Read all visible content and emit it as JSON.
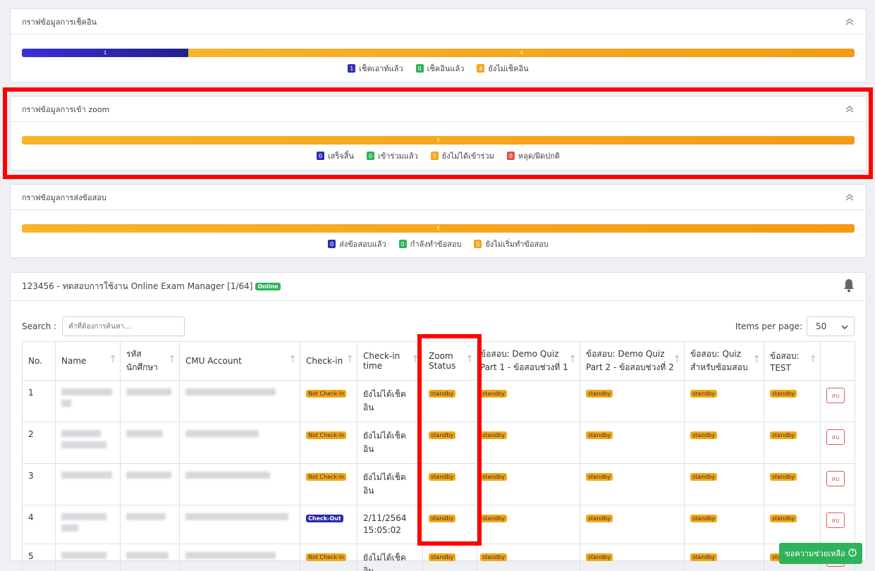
{
  "checkin_card": {
    "title": "กราฟข้อมูลการเช็คอิน",
    "segments": [
      {
        "label": "1",
        "value": 1
      },
      {
        "label": "4",
        "value": 4
      }
    ],
    "legend": [
      {
        "count": "1",
        "label": "เช็คเอาท์แล้ว",
        "color": "#2f2fb3"
      },
      {
        "count": "0",
        "label": "เช็คอินแล้ว",
        "color": "#2fb35a"
      },
      {
        "count": "4",
        "label": "ยังไม่เช็คอิน",
        "color": "#f2a71a"
      }
    ]
  },
  "zoom_card": {
    "title": "กราฟข้อมูลการเข้า zoom",
    "segments": [
      {
        "label": "5",
        "value": 5
      }
    ],
    "legend": [
      {
        "count": "0",
        "label": "เสร็จสิ้น",
        "color": "#2f2fb3"
      },
      {
        "count": "0",
        "label": "เข้าร่วมแล้ว",
        "color": "#2fb35a"
      },
      {
        "count": "5",
        "label": "ยังไม่ได้เข้าร่วม",
        "color": "#f2a71a"
      },
      {
        "count": "0",
        "label": "หลุด/ผิดปกติ",
        "color": "#e0534e"
      }
    ]
  },
  "submit_card": {
    "title": "กราฟข้อมูลการส่งข้อสอบ",
    "segments": [
      {
        "label": "5",
        "value": 5
      }
    ],
    "legend": [
      {
        "count": "0",
        "label": "ส่งข้อสอบแล้ว",
        "color": "#2f2fb3"
      },
      {
        "count": "0",
        "label": "กำลังทำข้อสอบ",
        "color": "#2fb35a"
      },
      {
        "count": "5",
        "label": "ยังไม่เริ่มทำข้อสอบ",
        "color": "#f2a71a"
      }
    ]
  },
  "exam": {
    "title": "123456 - ทดสอบการใช้งาน Online Exam Manager [1/64]",
    "online_badge": "Online",
    "search_label": "Search :",
    "search_placeholder": "คำที่ต้องการค้นหา...",
    "per_page_label": "Items per page:",
    "per_page_value": "50",
    "columns": [
      "No.",
      "Name",
      "รหัส นักศึกษา",
      "CMU Account",
      "Check-in",
      "Check-in time",
      "Zoom Status",
      "ข้อสอบ: Demo Quiz Part 1 - ข้อสอบช่วงที่ 1",
      "ข้อสอบ: Demo Quiz Part 2 - ข้อสอบช่วงที่ 2",
      "ข้อสอบ: Quiz สำหรับซ้อมสอบ",
      "ข้อสอบ: TEST",
      ""
    ],
    "rows": [
      {
        "no": "1",
        "checkin": "Not Check-In",
        "checkin_time": "ยังไม่ได้เช็คอิน",
        "zoom": "standby",
        "q1": "standby",
        "q2": "standby",
        "q3": "standby",
        "q4": "standby",
        "delete": "ลบ"
      },
      {
        "no": "2",
        "checkin": "Not Check-In",
        "checkin_time": "ยังไม่ได้เช็คอิน",
        "zoom": "standby",
        "q1": "standby",
        "q2": "standby",
        "q3": "standby",
        "q4": "standby",
        "delete": "ลบ"
      },
      {
        "no": "3",
        "checkin": "Not Check-In",
        "checkin_time": "ยังไม่ได้เช็คอิน",
        "zoom": "standby",
        "q1": "standby",
        "q2": "standby",
        "q3": "standby",
        "q4": "standby",
        "delete": "ลบ"
      },
      {
        "no": "4",
        "checkin": "Check-Out",
        "checkin_time": "2/11/2564 15:05:02",
        "zoom": "standby",
        "q1": "standby",
        "q2": "standby",
        "q3": "standby",
        "q4": "standby",
        "delete": "ลบ"
      },
      {
        "no": "5",
        "checkin": "Not Check-In",
        "checkin_time": "ยังไม่ได้เช็คอิน",
        "zoom": "standby",
        "q1": "standby",
        "q2": "standby",
        "q3": "standby",
        "q4": "standby",
        "delete": "ลบ"
      }
    ]
  },
  "help_button": "ขอความช่วยเหลือ",
  "icons": {
    "collapse": "chevron-up-icon",
    "bell": "bell-icon",
    "help": "question-circle-icon",
    "sort": "arrow-up-icon",
    "select": "chevron-down-icon"
  }
}
